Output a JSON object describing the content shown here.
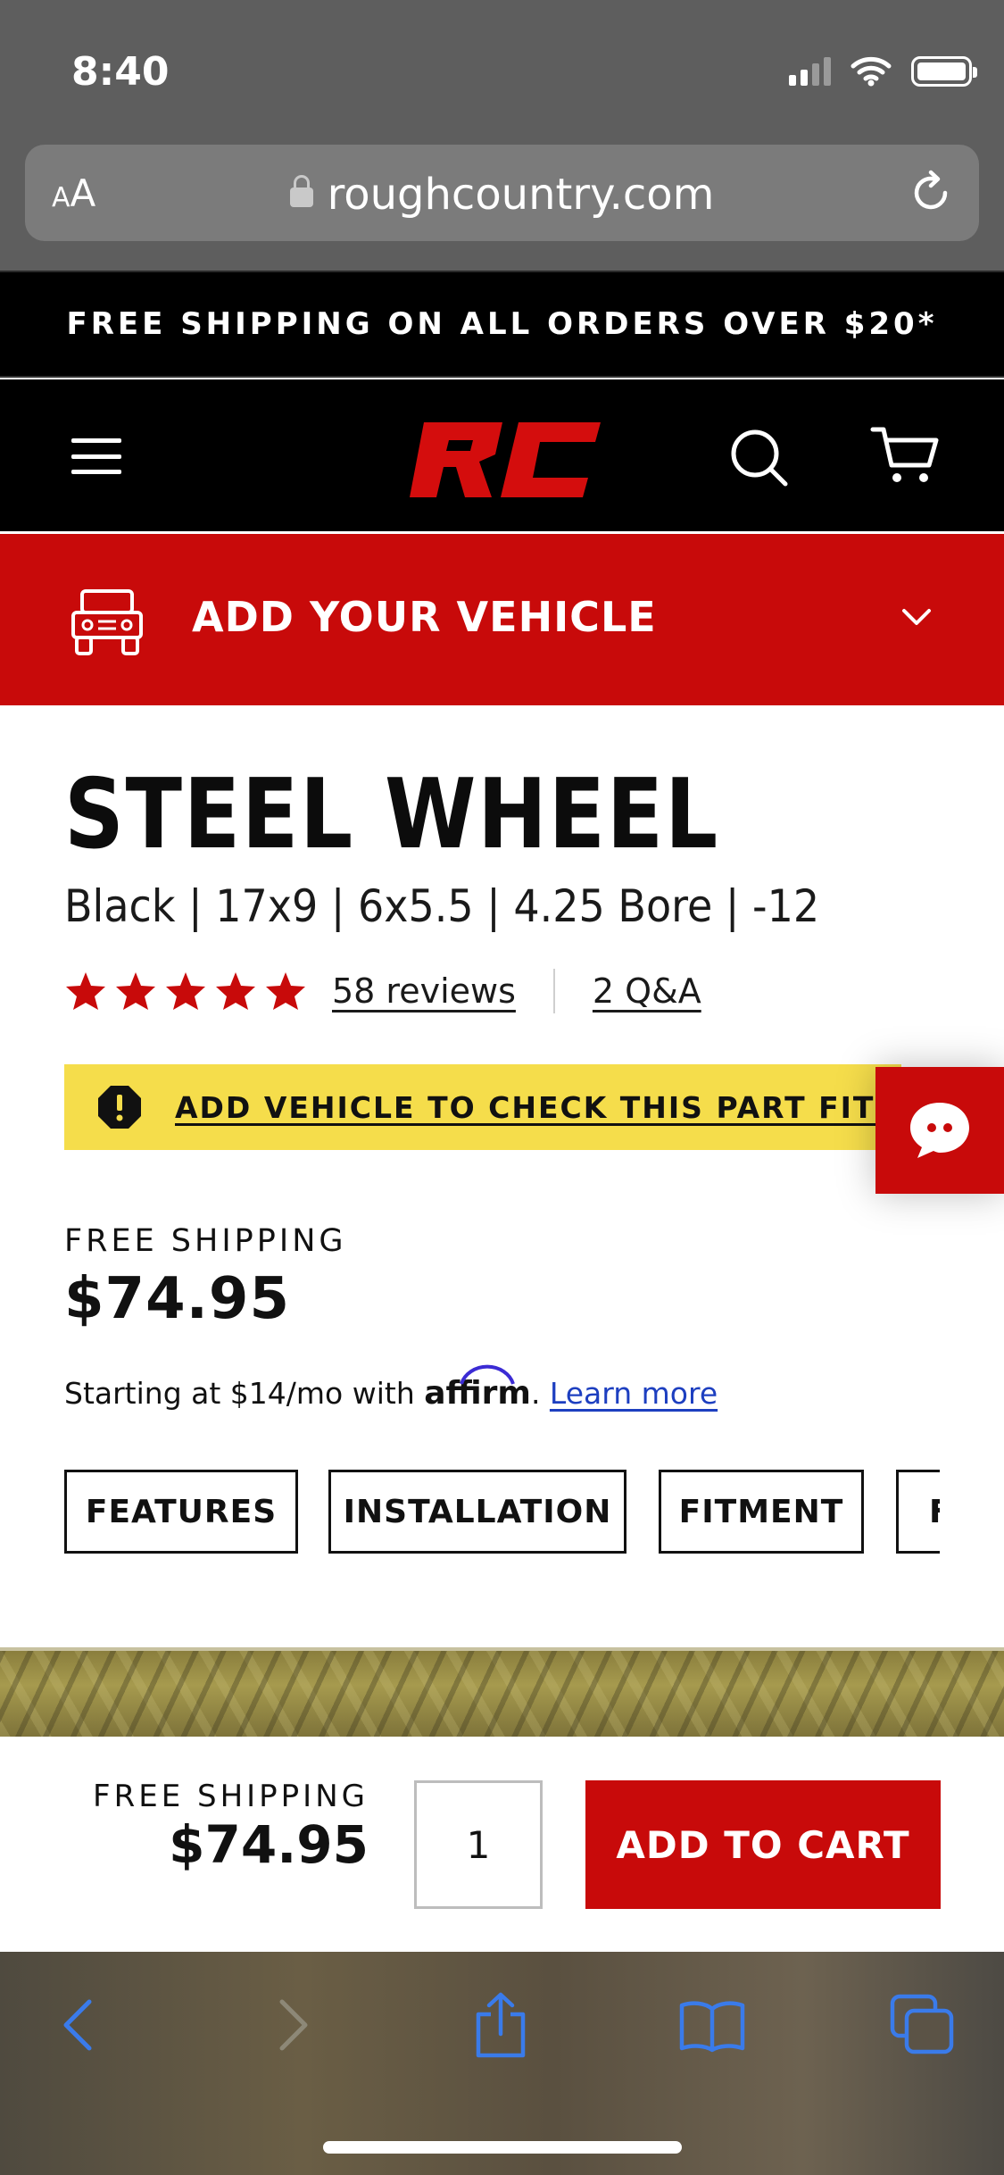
{
  "status_bar": {
    "time": "8:40"
  },
  "browser": {
    "text_size_label": "AA",
    "domain": "roughcountry.com"
  },
  "promo": {
    "text": "FREE SHIPPING ON ALL ORDERS OVER $20*"
  },
  "nav": {
    "logo": "RC"
  },
  "vehicle": {
    "label": "ADD YOUR VEHICLE"
  },
  "product": {
    "title": "STEEL WHEEL",
    "subtitle": "Black | 17x9 | 6x5.5 | 4.25 Bore | -12",
    "rating": 5,
    "rating_max": 5,
    "reviews_label": "58 reviews",
    "qa_label": "2 Q&A",
    "fit_alert": "ADD VEHICLE TO CHECK THIS PART FITS",
    "shipping_label": "FREE SHIPPING",
    "price": "$74.95",
    "affirm": {
      "prefix": "Starting at $14/mo with ",
      "brand": "affirm",
      "suffix": ". ",
      "link": "Learn more"
    },
    "tabs": [
      "FEATURES",
      "INSTALLATION",
      "FITMENT",
      "F"
    ]
  },
  "sticky_cart": {
    "shipping_label": "FREE SHIPPING",
    "price": "$74.95",
    "quantity": "1",
    "add_label": "ADD TO CART"
  },
  "colors": {
    "brand_red": "#c80a0a",
    "alert_yellow": "#f5dd4b",
    "link_blue": "#1d3fc0",
    "safari_blue": "#3a7bea"
  }
}
